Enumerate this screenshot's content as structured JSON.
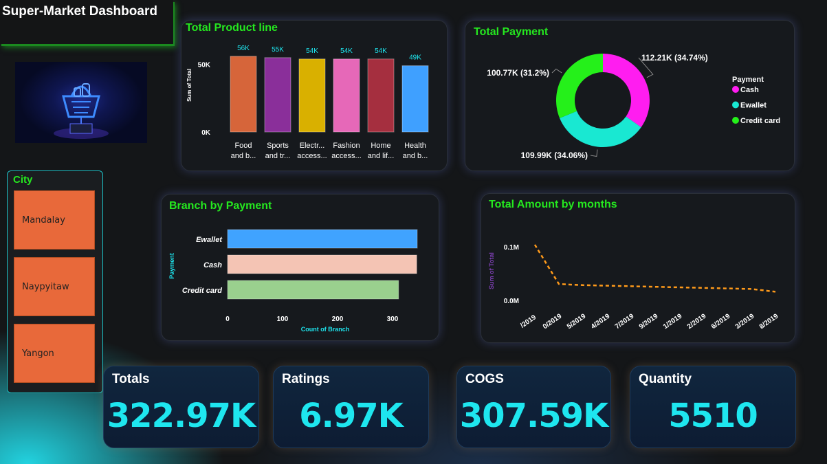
{
  "header": {
    "title": "Super-Market Dashboard"
  },
  "logo": {
    "icon": "neon-shopping-basket-icon"
  },
  "city_slicer": {
    "title": "City",
    "items": [
      "Mandalay",
      "Naypyitaw",
      "Yangon"
    ],
    "button_color": "#e8693a"
  },
  "kpis": [
    {
      "label": "Totals",
      "value": "322.97K"
    },
    {
      "label": "Ratings",
      "value": "6.97K"
    },
    {
      "label": "COGS",
      "value": "307.59K"
    },
    {
      "label": "Quantity",
      "value": "5510"
    }
  ],
  "titles": {
    "product": "Total Product line",
    "payment": "Total Payment",
    "branch": "Branch by Payment",
    "months": "Total Amount by months"
  },
  "chart_data": [
    {
      "type": "bar",
      "title": "Total Product line",
      "ylabel": "Sum of Total",
      "yticks": [
        "0K",
        "50K"
      ],
      "ylim": [
        0,
        60
      ],
      "categories": [
        [
          "Food",
          "and b..."
        ],
        [
          "Sports",
          "and tr..."
        ],
        [
          "Electr...",
          "access..."
        ],
        [
          "Fashion",
          "access..."
        ],
        [
          "Home",
          "and lif..."
        ],
        [
          "Health",
          "and b..."
        ]
      ],
      "values": [
        56,
        55,
        54,
        54,
        54,
        49
      ],
      "data_labels": [
        "56K",
        "55K",
        "54K",
        "54K",
        "54K",
        "49K"
      ],
      "colors": [
        "#d6653a",
        "#8a2f9a",
        "#d9b000",
        "#e668b8",
        "#a52f3f",
        "#3fa0ff"
      ]
    },
    {
      "type": "pie",
      "title": "Total Payment",
      "legend_title": "Payment",
      "legend_position": "right",
      "slices": [
        {
          "name": "Cash",
          "value": 112.21,
          "label": "112.21K (34.74%)",
          "color": "#ff1df0"
        },
        {
          "name": "Ewallet",
          "value": 109.99,
          "label": "109.99K (34.06%)",
          "color": "#19e8d2"
        },
        {
          "name": "Credit card",
          "value": 100.77,
          "label": "100.77K (31.2%)",
          "color": "#25f01a"
        }
      ]
    },
    {
      "type": "bar",
      "orientation": "horizontal",
      "title": "Branch by Payment",
      "xlabel": "Count of Branch",
      "ylabel": "Payment",
      "xlim": [
        0,
        350
      ],
      "xticks": [
        "0",
        "100",
        "200",
        "300"
      ],
      "categories": [
        "Ewallet",
        "Cash",
        "Credit card"
      ],
      "values": [
        345,
        344,
        311
      ],
      "colors": [
        "#40a3ff",
        "#f4c4b4",
        "#9ad08e"
      ]
    },
    {
      "type": "line",
      "title": "Total Amount by months",
      "ylabel": "Sum of Total",
      "yticks": [
        "0.0M",
        "0.1M"
      ],
      "ylim": [
        0,
        0.1
      ],
      "x": [
        "/2019",
        "0/2019",
        "5/2019",
        "4/2019",
        "7/2019",
        "9/2019",
        "1/2019",
        "2/2019",
        "6/2019",
        "3/2019",
        "8/2019"
      ],
      "values": [
        0.107,
        0.031,
        0.029,
        0.028,
        0.027,
        0.026,
        0.025,
        0.024,
        0.023,
        0.022,
        0.017
      ],
      "line_color": "#ff9a1a",
      "style": "dashed"
    }
  ]
}
